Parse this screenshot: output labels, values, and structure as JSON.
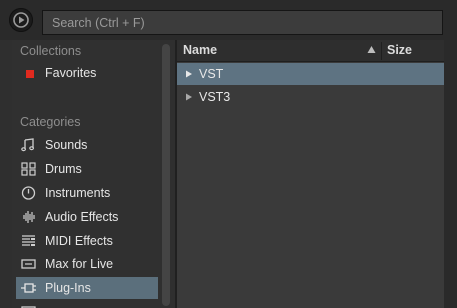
{
  "search": {
    "placeholder": "Search (Ctrl + F)"
  },
  "sidebar": {
    "collections_title": "Collections",
    "favorites": {
      "label": "Favorites",
      "color": "#e02a1f"
    },
    "categories_title": "Categories",
    "items": [
      {
        "label": "Sounds",
        "icon": "music-note-icon"
      },
      {
        "label": "Drums",
        "icon": "drum-grid-icon"
      },
      {
        "label": "Instruments",
        "icon": "instrument-clock-icon"
      },
      {
        "label": "Audio Effects",
        "icon": "waveform-icon"
      },
      {
        "label": "MIDI Effects",
        "icon": "midi-lines-icon"
      },
      {
        "label": "Max for Live",
        "icon": "max-device-icon"
      },
      {
        "label": "Plug-Ins",
        "icon": "plugin-icon",
        "selected": true
      }
    ]
  },
  "table": {
    "col_name": "Name",
    "col_size": "Size",
    "rows": [
      {
        "label": "VST",
        "selected": true
      },
      {
        "label": "VST3",
        "selected": false
      }
    ]
  },
  "colors": {
    "selection": "#5e7382",
    "accent_red": "#e02a1f"
  }
}
